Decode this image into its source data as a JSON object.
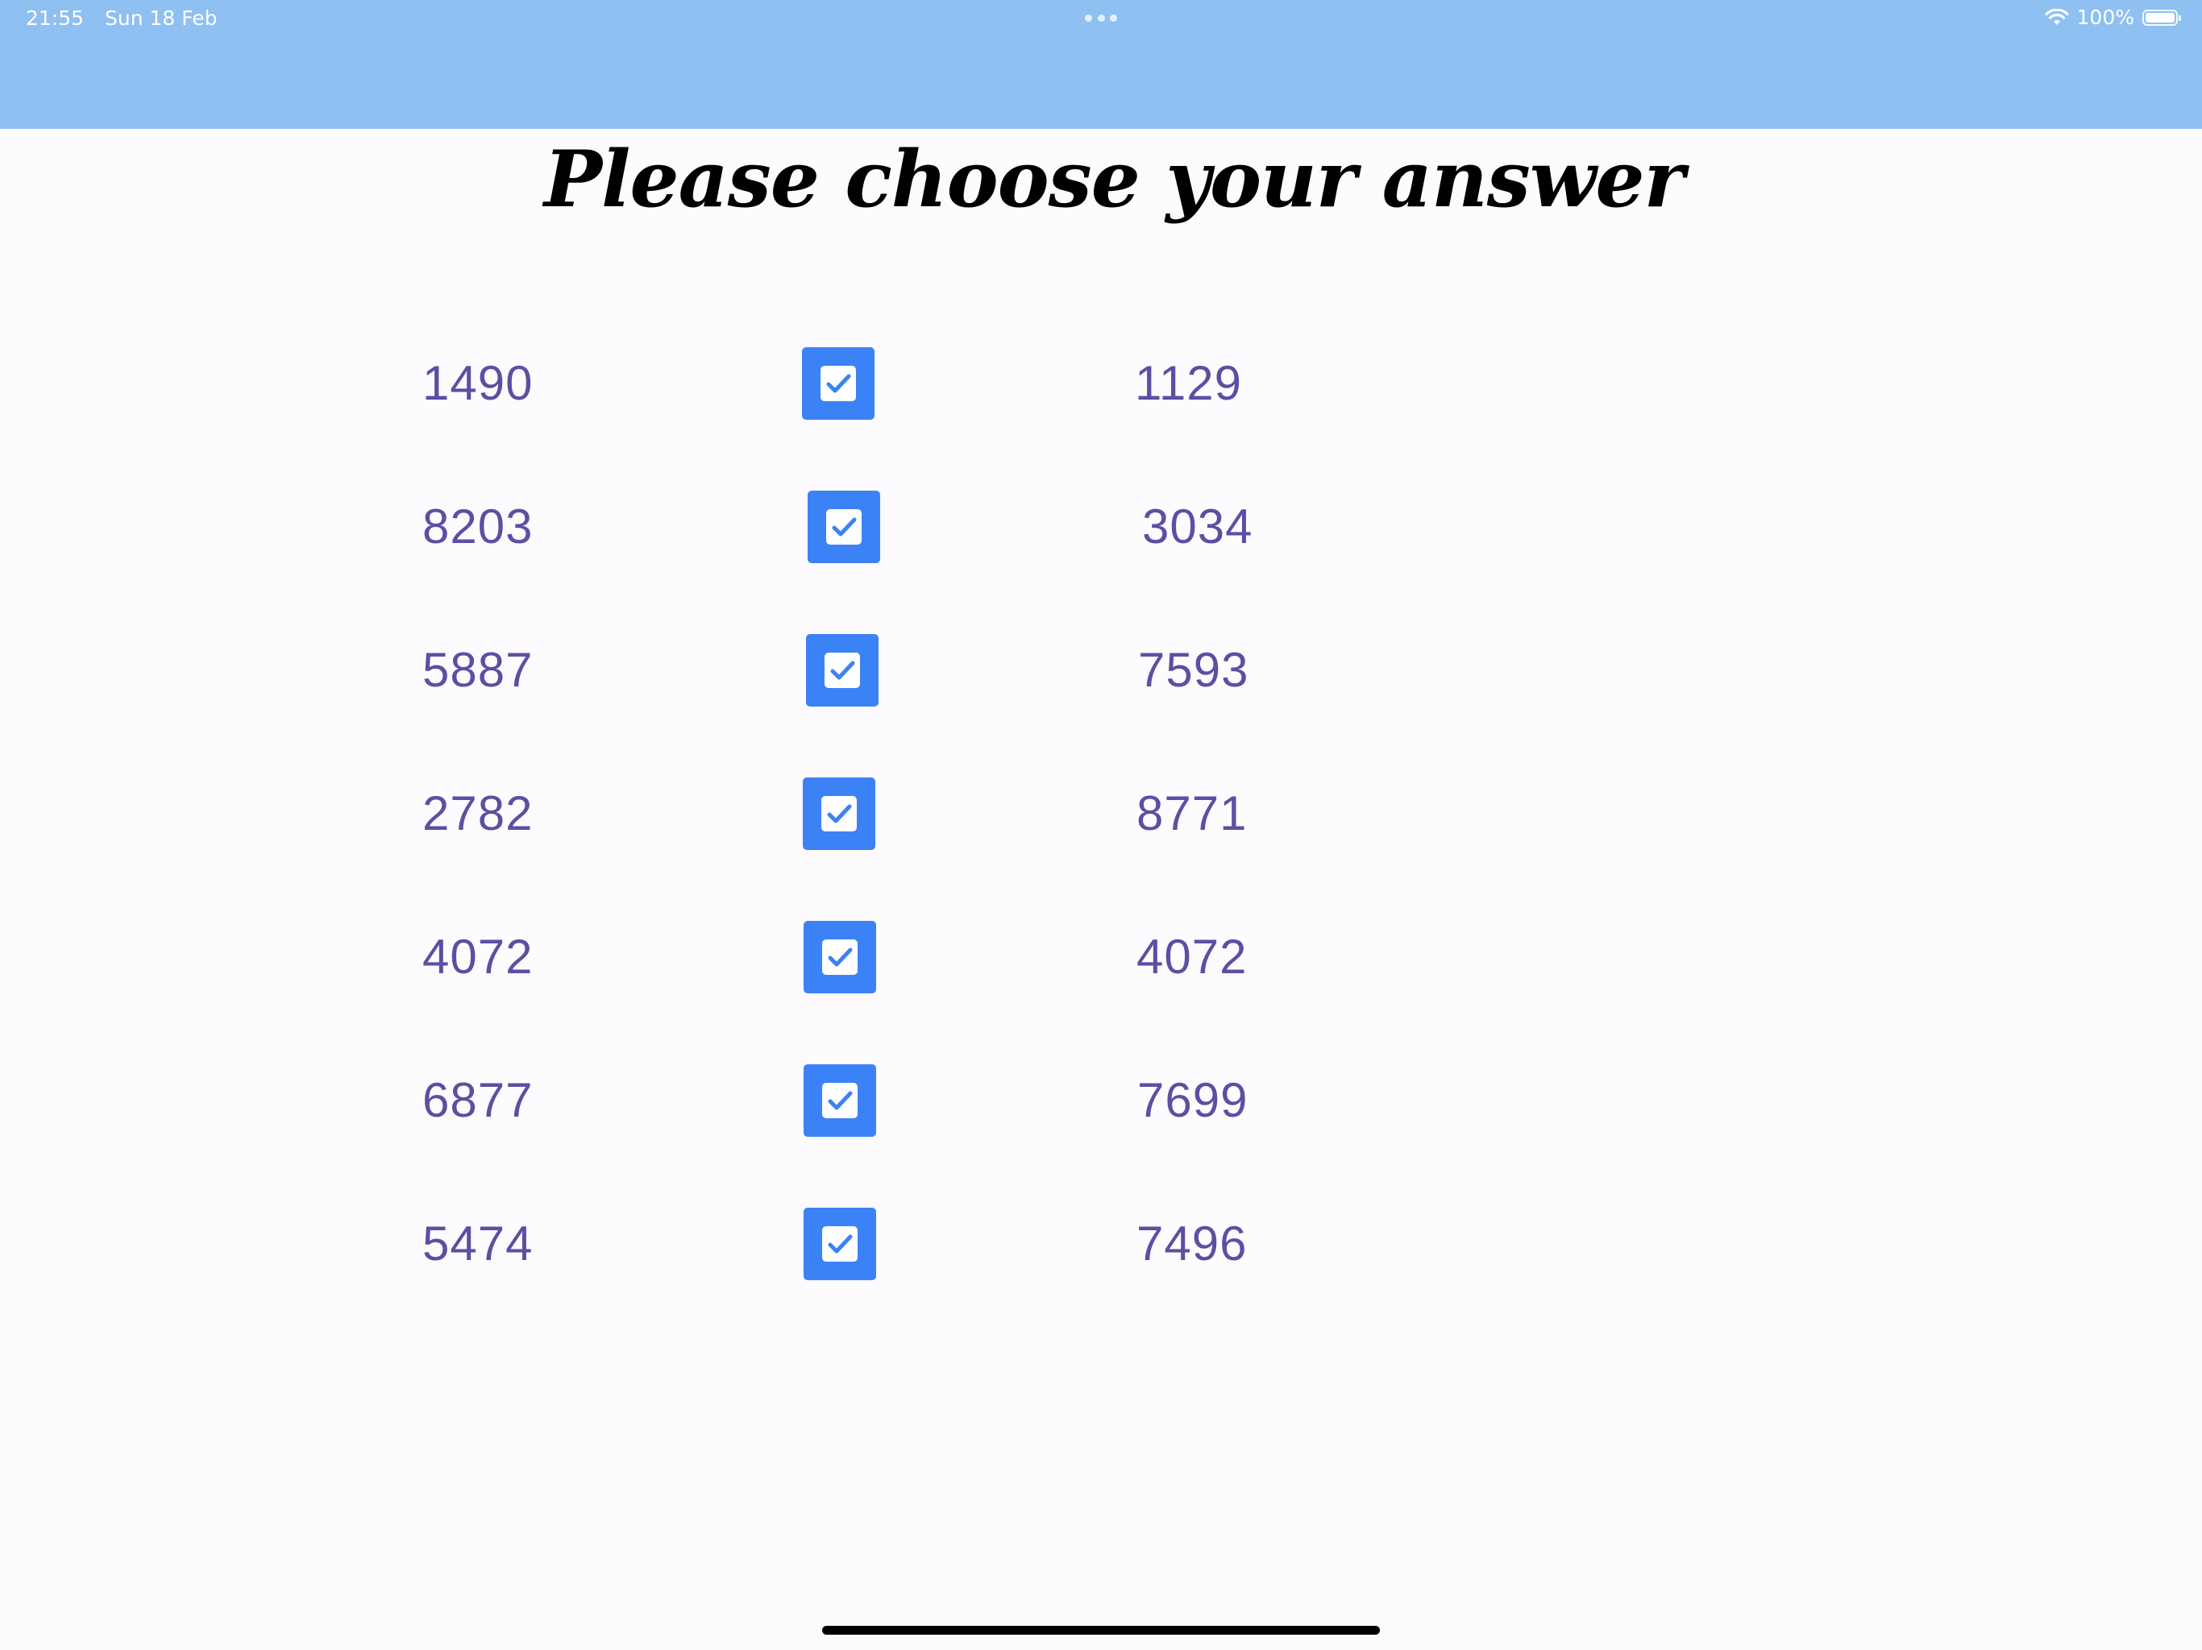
{
  "status_bar": {
    "time": "21:55",
    "date": "Sun 18 Feb",
    "battery": "100%",
    "battery_level": 1.0
  },
  "colors": {
    "header": "#8ec0f1",
    "checkbox": "#3b82f6",
    "number_text": "#5e4ea3",
    "title_text": "#000000"
  },
  "title": "Please choose your answer",
  "rows": [
    {
      "left": "1490",
      "right": "1129",
      "checked": true
    },
    {
      "left": "8203",
      "right": "3034",
      "checked": true
    },
    {
      "left": "5887",
      "right": "7593",
      "checked": true
    },
    {
      "left": "2782",
      "right": "8771",
      "checked": true
    },
    {
      "left": "4072",
      "right": "4072",
      "checked": true
    },
    {
      "left": "6877",
      "right": "7699",
      "checked": true
    },
    {
      "left": "5474",
      "right": "7496",
      "checked": true
    }
  ]
}
